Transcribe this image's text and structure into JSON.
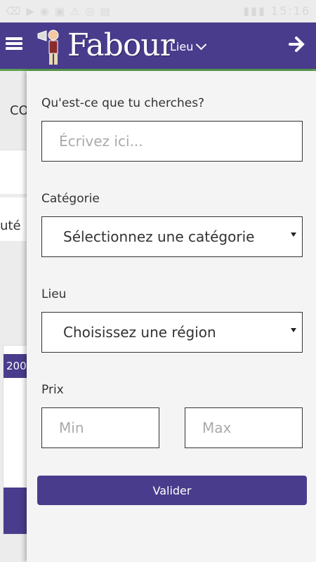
{
  "status_bar": {
    "time": "15:16"
  },
  "header": {
    "logo": "Fabour",
    "location_label": "Lieu"
  },
  "background_page": {
    "text1": "CO",
    "text2": "uté",
    "panel_label": "200"
  },
  "search_panel": {
    "query_label": "Qu'est-ce que tu cherches?",
    "query_placeholder": "Écrivez ici...",
    "category_label": "Catégorie",
    "category_value": "Sélectionnez une catégorie",
    "location_label": "Lieu",
    "location_value": "Choisissez une région",
    "price_label": "Prix",
    "min_placeholder": "Min",
    "max_placeholder": "Max",
    "submit_label": "Valider"
  },
  "colors": {
    "primary": "#4a3c8c",
    "accent_line": "#5aa050"
  }
}
